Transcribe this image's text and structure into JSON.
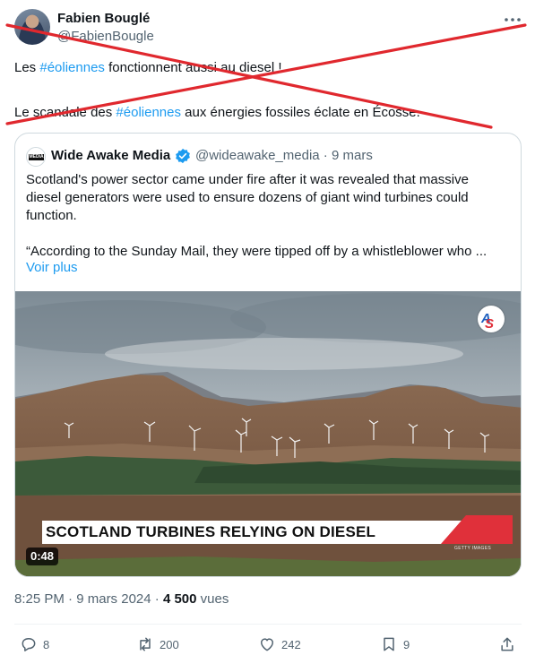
{
  "author": {
    "name": "Fabien Bouglé",
    "handle": "@FabienBougle"
  },
  "tweet": {
    "line1": {
      "before": "Les ",
      "hashtag": "#éoliennes",
      "after": " fonctionnent aussi au diesel !"
    },
    "line2": {
      "before": "Le scandale des ",
      "hashtag": "#éoliennes",
      "after": " aux énergies fossiles éclate en Écosse."
    }
  },
  "overlay": {
    "cross_color": "#e0282e"
  },
  "quote": {
    "logo_text": "MEDIA",
    "name": "Wide Awake Media",
    "handle": "@wideawake_media",
    "separator": " · ",
    "date": "9 mars",
    "text_lines": [
      "Scotland's power sector came under fire after it was revealed that massive",
      "diesel generators were used to ensure dozens of giant wind turbines could",
      "function.",
      "“According to the Sunday Mail, they were tipped off by a whistleblower who ..."
    ],
    "read_more": "Voir plus",
    "media": {
      "banner_text": "SCOTLAND TURBINES RELYING ON DIESEL",
      "credit": "GETTY IMAGES",
      "logo": {
        "s": "S",
        "a": "A"
      },
      "duration": "0:48"
    }
  },
  "meta": {
    "time": "8:25 PM",
    "sep1": " · ",
    "date": "9 mars 2024",
    "sep2": " · ",
    "views": "4 500",
    "views_label": " vues"
  },
  "actions": {
    "replies": "8",
    "reposts": "200",
    "likes": "242",
    "bookmarks": "9"
  },
  "colors": {
    "accent": "#1d9bf0",
    "text": "#0f1419",
    "muted": "#536471",
    "border": "#cfd9de",
    "brand_red": "#e0303a"
  }
}
